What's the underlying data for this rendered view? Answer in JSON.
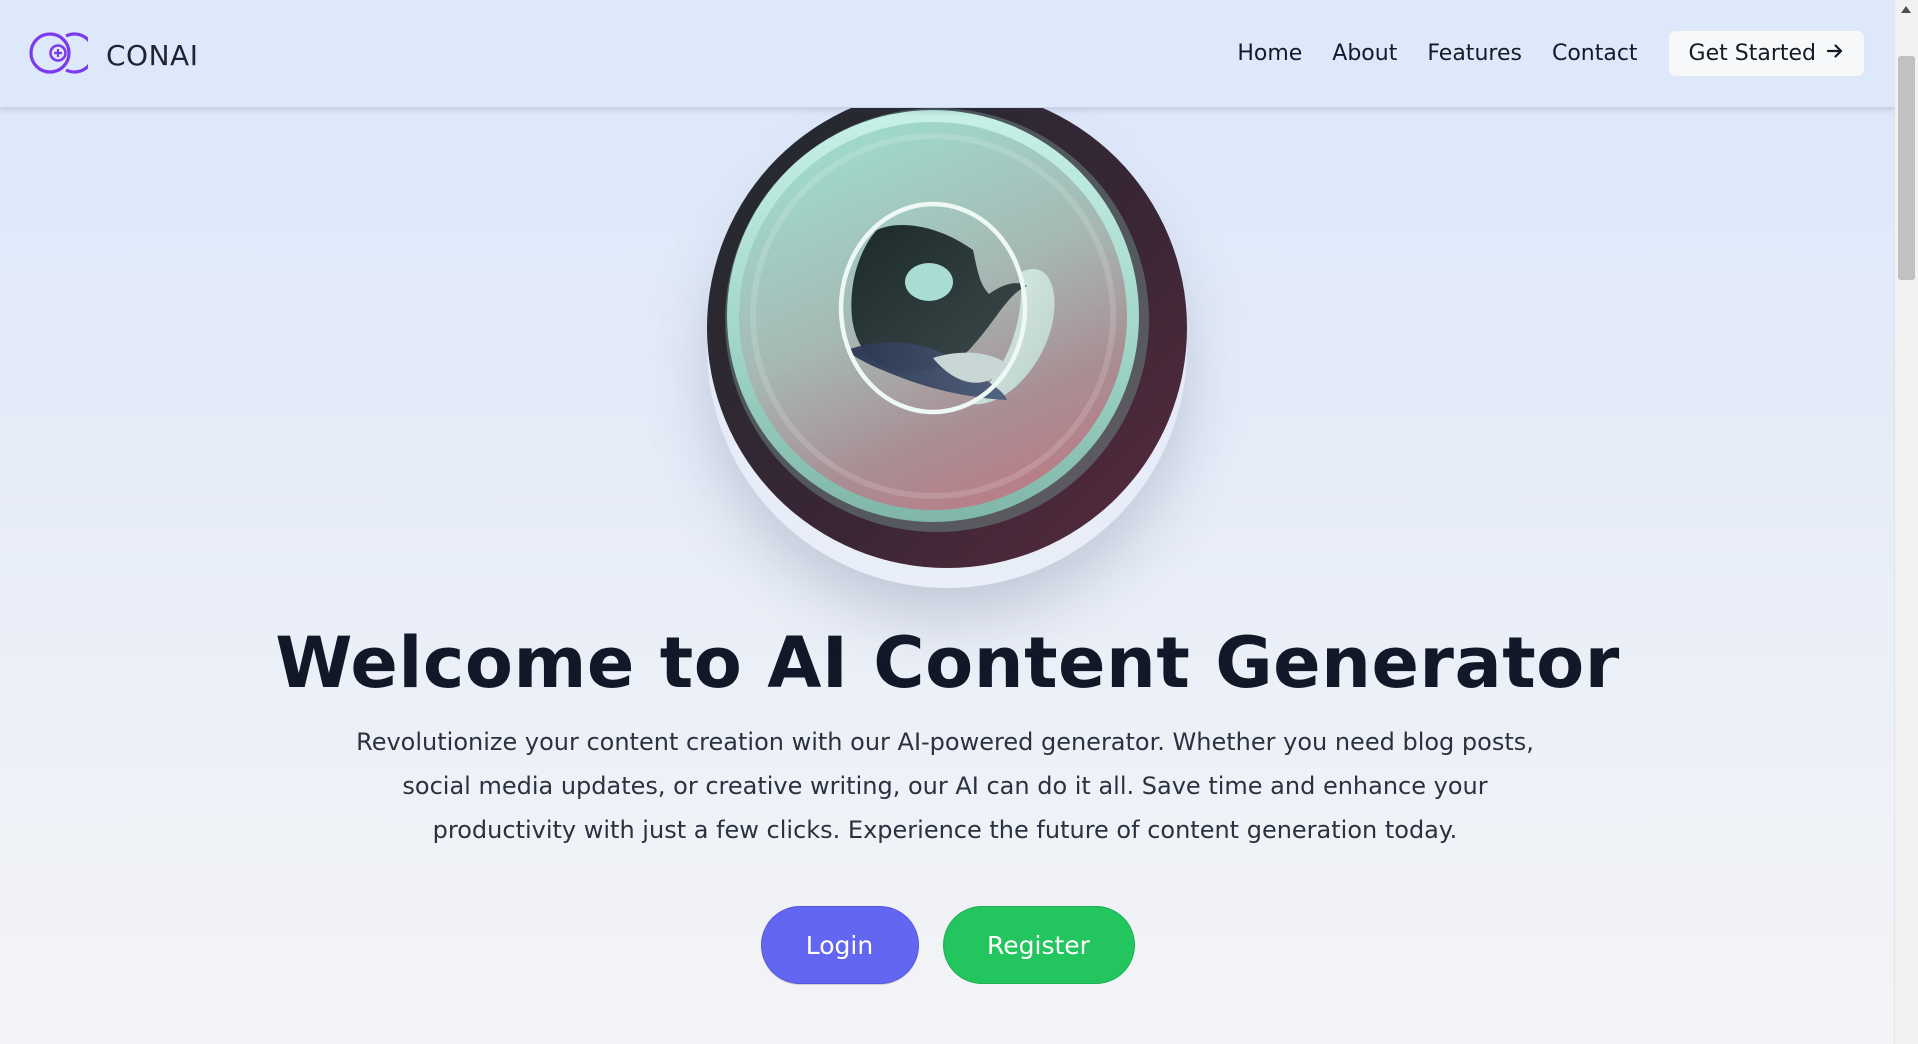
{
  "navbar": {
    "brand_name": "CONAI",
    "links": [
      {
        "label": "Home"
      },
      {
        "label": "About"
      },
      {
        "label": "Features"
      },
      {
        "label": "Contact"
      }
    ],
    "cta_label": "Get Started"
  },
  "hero": {
    "headline": "Welcome to AI Content Generator",
    "description": "Revolutionize your content creation with our AI-powered generator. Whether you need blog posts, social media updates, or creative writing, our AI can do it all. Save time and enhance your productivity with just a few clicks. Experience the future of content generation today.",
    "login_label": "Login",
    "register_label": "Register"
  },
  "colors": {
    "accent_login": "#6366f1",
    "accent_register": "#22c55e",
    "brand_icon": "#7c3aed"
  },
  "icons": {
    "logo": "conai-logo-icon",
    "cta_arrow": "arrow-right-icon",
    "hero": "ai-emblem-icon"
  }
}
